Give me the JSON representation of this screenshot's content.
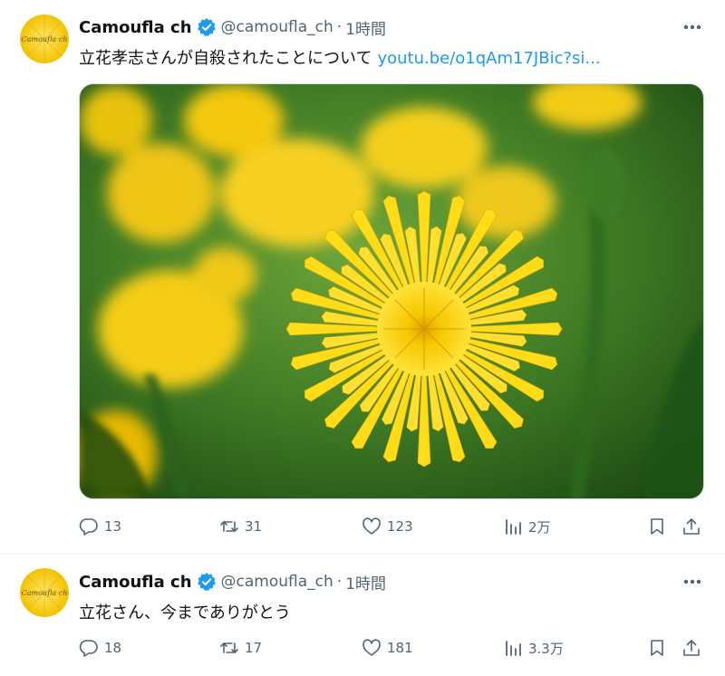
{
  "tweets": [
    {
      "display_name": "Camoufla ch",
      "handle": "@camoufla_ch",
      "separator": "·",
      "time": "1時間",
      "avatar_text": "Camoufla ch",
      "text": "立花孝志さんが自殺されたことについて",
      "link": "youtu.be/o1qAm17JBic?si...",
      "has_media": true,
      "media_subject": "yellow-dandelion-photo",
      "stats": {
        "replies": "13",
        "retweets": "31",
        "likes": "123",
        "views": "2万"
      }
    },
    {
      "display_name": "Camoufla ch",
      "handle": "@camoufla_ch",
      "separator": "·",
      "time": "1時間",
      "avatar_text": "Camoufla ch",
      "text": "立花さん、今までありがとう",
      "stats": {
        "replies": "18",
        "retweets": "17",
        "likes": "181",
        "views": "3.3万"
      }
    }
  ],
  "colors": {
    "text": "#0f1419",
    "secondary": "#536471",
    "link": "#1d9bf0",
    "verified": "#1d9bf0",
    "avatar_yellow": "#f5d300"
  },
  "icons": [
    "reply-icon",
    "retweet-icon",
    "like-icon",
    "views-icon",
    "bookmark-icon",
    "share-icon",
    "more-icon",
    "verified-badge-icon"
  ]
}
